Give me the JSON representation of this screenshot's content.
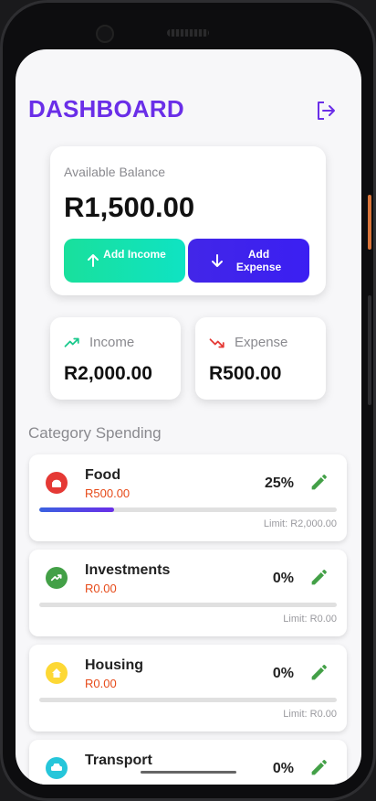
{
  "header": {
    "title": "DASHBOARD",
    "logout_icon": "logout-icon"
  },
  "balance": {
    "label": "Available Balance",
    "value": "R1,500.00",
    "add_income_label": "Add Income",
    "add_expense_label": "Add Expense"
  },
  "stats": {
    "income": {
      "label": "Income",
      "value": "R2,000.00",
      "icon": "trending-up-icon"
    },
    "expense": {
      "label": "Expense",
      "value": "R500.00",
      "icon": "trending-down-icon"
    }
  },
  "categories": {
    "title": "Category Spending",
    "items": [
      {
        "name": "Food",
        "amount": "R500.00",
        "percent": "25%",
        "progress": 0.25,
        "limit": "Limit: R2,000.00",
        "icon": "restaurant-icon",
        "color": "#e53935"
      },
      {
        "name": "Investments",
        "amount": "R0.00",
        "percent": "0%",
        "progress": 0,
        "limit": "Limit: R0.00",
        "icon": "trending-up-icon",
        "color": "#43a047"
      },
      {
        "name": "Housing",
        "amount": "R0.00",
        "percent": "0%",
        "progress": 0,
        "limit": "Limit: R0.00",
        "icon": "home-icon",
        "color": "#fdd835"
      },
      {
        "name": "Transport",
        "amount": "",
        "percent": "0%",
        "progress": 0,
        "limit": "",
        "icon": "car-icon",
        "color": "#26c6da"
      }
    ]
  },
  "colors": {
    "accent": "#6a2ee8",
    "income": "#19e09c",
    "expense": "#4226e8",
    "edit": "#43a047"
  }
}
